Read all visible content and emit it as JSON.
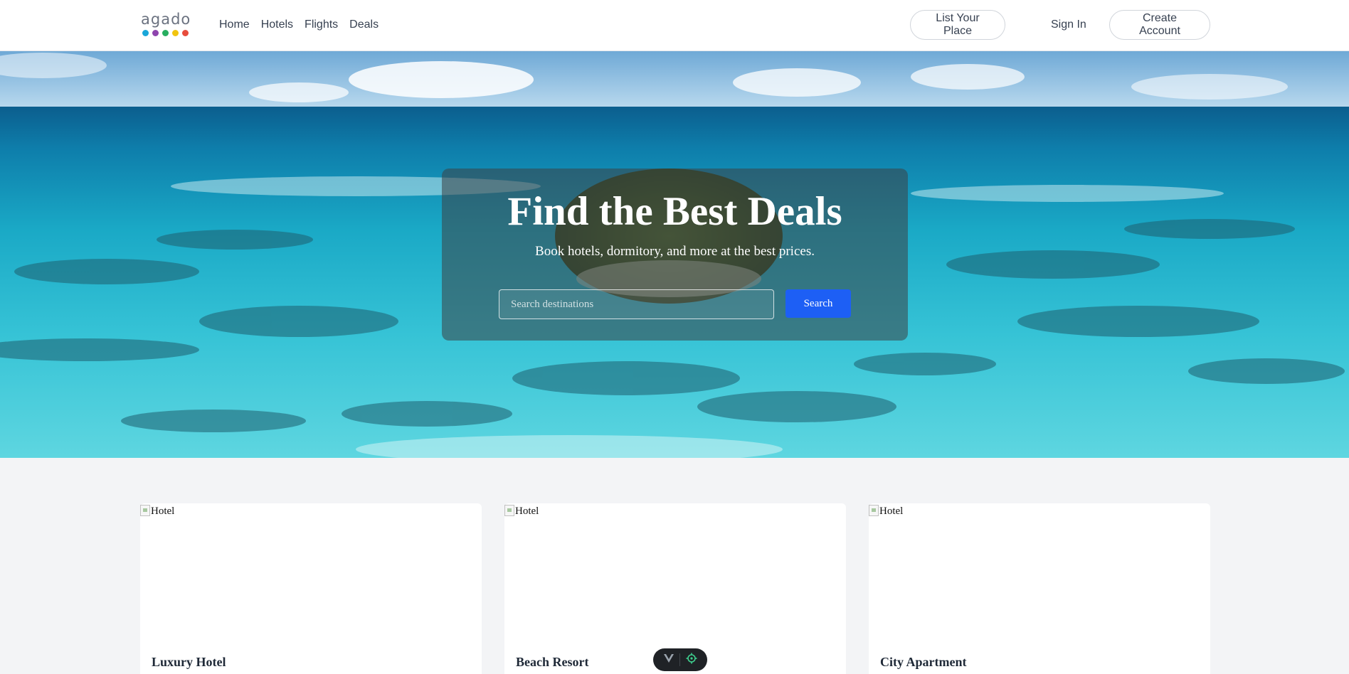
{
  "nav": {
    "logo_text": "agado",
    "logo_dot_colors": [
      "#1aa7d9",
      "#8e44ad",
      "#27ae60",
      "#f1c40f",
      "#e74c3c"
    ],
    "links": [
      "Home",
      "Hotels",
      "Flights",
      "Deals"
    ],
    "list_place_label": "List Your Place",
    "sign_in_label": "Sign In",
    "create_account_label": "Create Account"
  },
  "hero": {
    "title": "Find the Best Deals",
    "subtitle": "Book hotels, dormitory, and more at the best prices.",
    "search_placeholder": "Search destinations",
    "search_value": "",
    "search_button": "Search"
  },
  "cards": [
    {
      "image_alt": "Hotel",
      "title": "Luxury Hotel"
    },
    {
      "image_alt": "Hotel",
      "title": "Beach Resort"
    },
    {
      "image_alt": "Hotel",
      "title": "City Apartment"
    }
  ],
  "colors": {
    "accent": "#1d5ff5",
    "page_bg": "#f3f4f6"
  },
  "devbar": {
    "icons": [
      "vue-logo-icon",
      "target-icon"
    ]
  }
}
